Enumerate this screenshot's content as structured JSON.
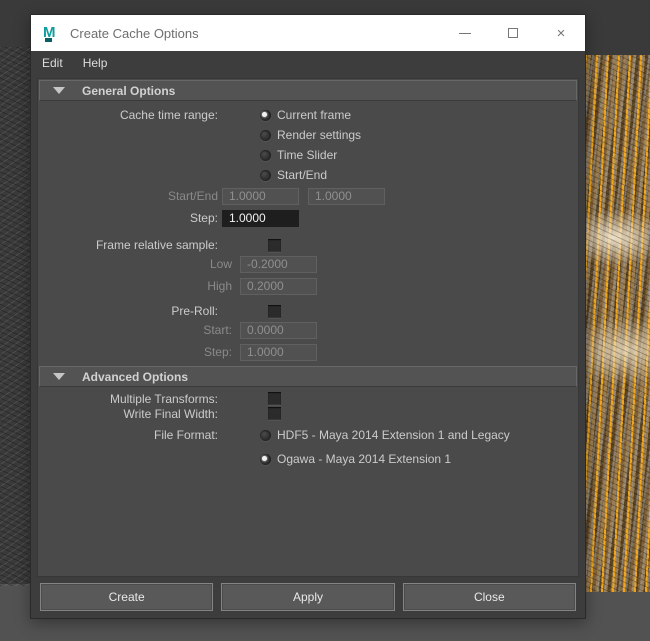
{
  "window": {
    "title": "Create Cache Options",
    "menu": {
      "edit": "Edit",
      "help": "Help"
    },
    "controls": {
      "minimize": "minimize",
      "maximize": "maximize",
      "close": "×"
    }
  },
  "colors": {
    "titlebar_bg": "#ffffff",
    "logo_teal": "#0f9c9c",
    "panel_bg": "#4a4a4a",
    "chrome_bg": "#3d3d3d",
    "active_field_bg": "#1e1e1e",
    "fur_orange": "#f4a41c",
    "fur_tan": "#9a7c4e"
  },
  "sections": {
    "general": {
      "title": "General Options"
    },
    "advanced": {
      "title": "Advanced Options"
    }
  },
  "general": {
    "cache_time_range": {
      "label": "Cache time range:",
      "options": [
        {
          "label": "Current frame",
          "selected": true
        },
        {
          "label": "Render settings",
          "selected": false
        },
        {
          "label": "Time Slider",
          "selected": false
        },
        {
          "label": "Start/End",
          "selected": false
        }
      ]
    },
    "start_end": {
      "label": "Start/End",
      "start": "1.0000",
      "end": "1.0000",
      "disabled": true
    },
    "step": {
      "label": "Step:",
      "value": "1.0000",
      "disabled": false
    },
    "frame_relative_sample": {
      "label": "Frame relative sample:",
      "checked": false
    },
    "low": {
      "label": "Low",
      "value": "-0.2000",
      "disabled": true
    },
    "high": {
      "label": "High",
      "value": "0.2000",
      "disabled": true
    },
    "pre_roll": {
      "label": "Pre-Roll:",
      "checked": false
    },
    "pre_start": {
      "label": "Start:",
      "value": "0.0000",
      "disabled": true
    },
    "pre_step": {
      "label": "Step:",
      "value": "1.0000",
      "disabled": true
    }
  },
  "advanced": {
    "multiple_transforms": {
      "label": "Multiple Transforms:",
      "checked": false
    },
    "write_final_width": {
      "label": "Write Final Width:",
      "checked": false
    },
    "file_format": {
      "label": "File Format:",
      "options": [
        {
          "label": "HDF5 - Maya 2014 Extension 1 and Legacy",
          "selected": false
        },
        {
          "label": "Ogawa - Maya 2014 Extension 1",
          "selected": true
        }
      ]
    }
  },
  "footer": {
    "create": "Create",
    "apply": "Apply",
    "close": "Close"
  }
}
